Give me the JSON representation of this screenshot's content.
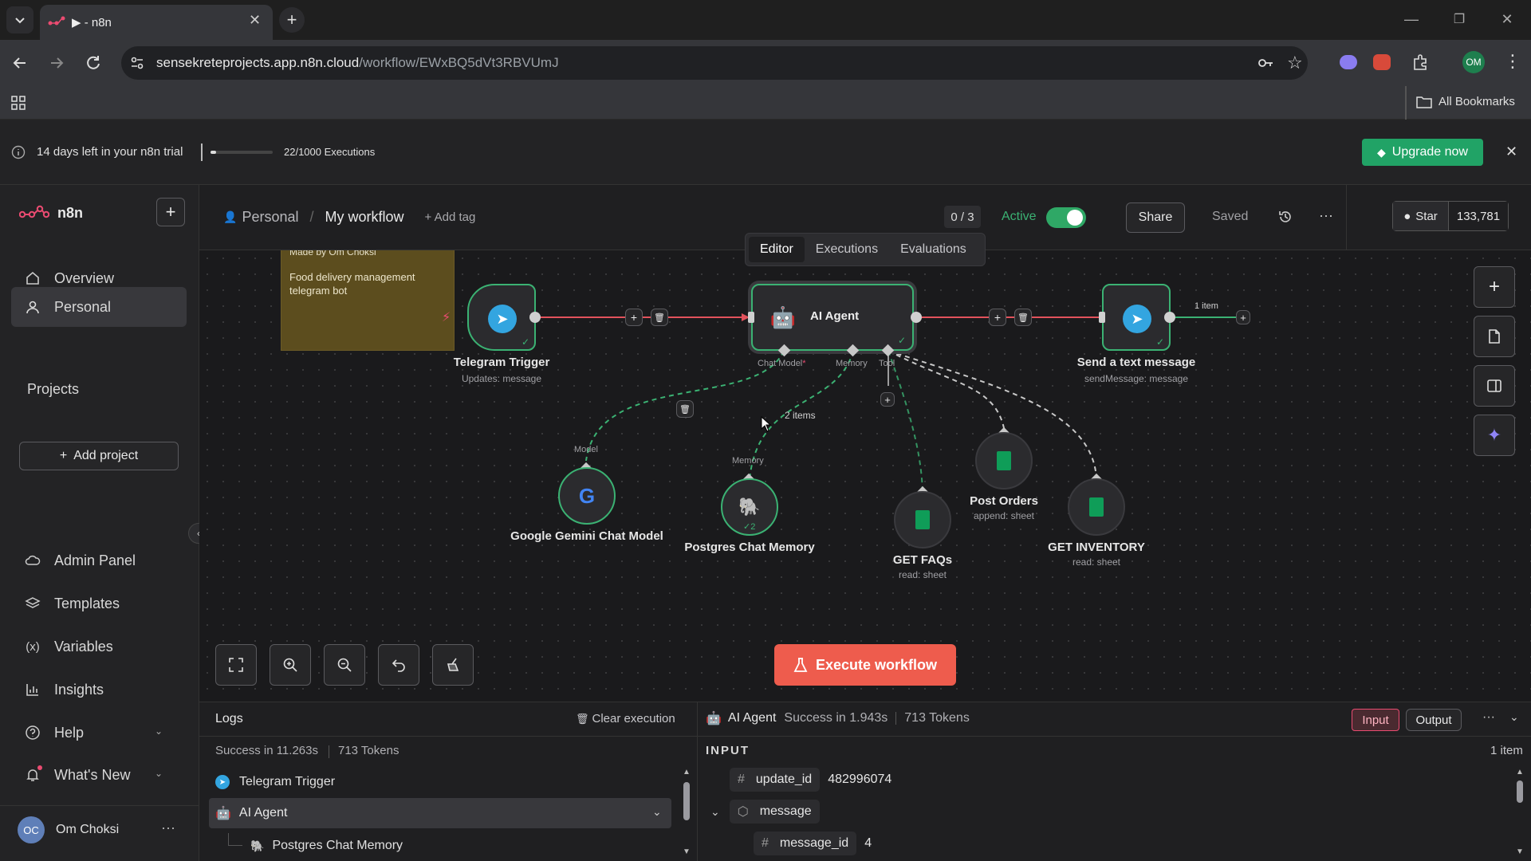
{
  "browser": {
    "tab_title": "▶ - n8n",
    "url_domain": "sensekreteprojects.app.n8n.cloud",
    "url_path": "/workflow/EWxBQ5dVt3RBVUmJ",
    "profile_initials": "OM",
    "bookmarks_label": "All Bookmarks"
  },
  "trial": {
    "text": "14 days left in your n8n trial",
    "executions": "22/1000 Executions",
    "executions_progress": 0.022,
    "upgrade_label": "Upgrade now"
  },
  "sidebar": {
    "brand": "n8n",
    "items": [
      {
        "label": "Overview"
      },
      {
        "label": "Personal"
      }
    ],
    "projects_heading": "Projects",
    "add_project_label": "Add project",
    "bottom_items": [
      {
        "label": "Admin Panel"
      },
      {
        "label": "Templates"
      },
      {
        "label": "Variables"
      },
      {
        "label": "Insights"
      },
      {
        "label": "Help"
      },
      {
        "label": "What's New"
      }
    ],
    "user": {
      "initials": "OC",
      "name": "Om Choksi"
    }
  },
  "header": {
    "breadcrumb_project": "Personal",
    "breadcrumb_sep": "/",
    "workflow_name": "My workflow",
    "add_tag": "+ Add tag",
    "counter": "0 / 3",
    "active_label": "Active",
    "share_label": "Share",
    "saved_label": "Saved",
    "star_label": "Star",
    "star_count": "133,781",
    "tabs": [
      {
        "label": "Editor",
        "active": true
      },
      {
        "label": "Executions",
        "active": false
      },
      {
        "label": "Evaluations",
        "active": false
      }
    ]
  },
  "canvas": {
    "sticky": {
      "line1": "Made by Om Choksi",
      "line2": "Food delivery management telegram bot"
    },
    "nodes": [
      {
        "name": "Telegram Trigger",
        "sub": "Updates: message"
      },
      {
        "name": "AI Agent"
      },
      {
        "name": "Send a text message",
        "sub": "sendMessage: message"
      },
      {
        "name": "Google Gemini Chat Model"
      },
      {
        "name": "Postgres Chat Memory"
      },
      {
        "name": "GET FAQs",
        "sub": "read: sheet"
      },
      {
        "name": "Post Orders",
        "sub": "append: sheet"
      },
      {
        "name": "GET INVENTORY",
        "sub": "read: sheet"
      }
    ],
    "ports": {
      "chat_model": "Chat Model",
      "memory": "Memory",
      "tool": "Tool",
      "model": "Model",
      "memory2": "Memory"
    },
    "edge_labels": {
      "items_1": "1 item",
      "items_2": "2 items",
      "memory_count": "2"
    },
    "execute_label": "Execute workflow"
  },
  "logs": {
    "title": "Logs",
    "clear_label": "Clear execution",
    "summary_status": "Success in 11.263s",
    "summary_tokens": "713 Tokens",
    "entries": [
      {
        "label": "Telegram Trigger"
      },
      {
        "label": "AI Agent"
      },
      {
        "label": "Postgres Chat Memory"
      }
    ]
  },
  "detail": {
    "node": "AI Agent",
    "status": "Success in 1.943s",
    "tokens": "713 Tokens",
    "input_label": "Input",
    "output_label": "Output",
    "section": "INPUT",
    "count": "1 item",
    "fields": [
      {
        "key": "update_id",
        "value": "482996074"
      },
      {
        "key": "message",
        "value": ""
      },
      {
        "key": "message_id",
        "value": "4"
      }
    ]
  },
  "colors": {
    "accent": "#ea4b71",
    "execute": "#ee5c4d",
    "green": "#3bb273",
    "node_border": "#3bb273",
    "edge": "#e2525c"
  }
}
